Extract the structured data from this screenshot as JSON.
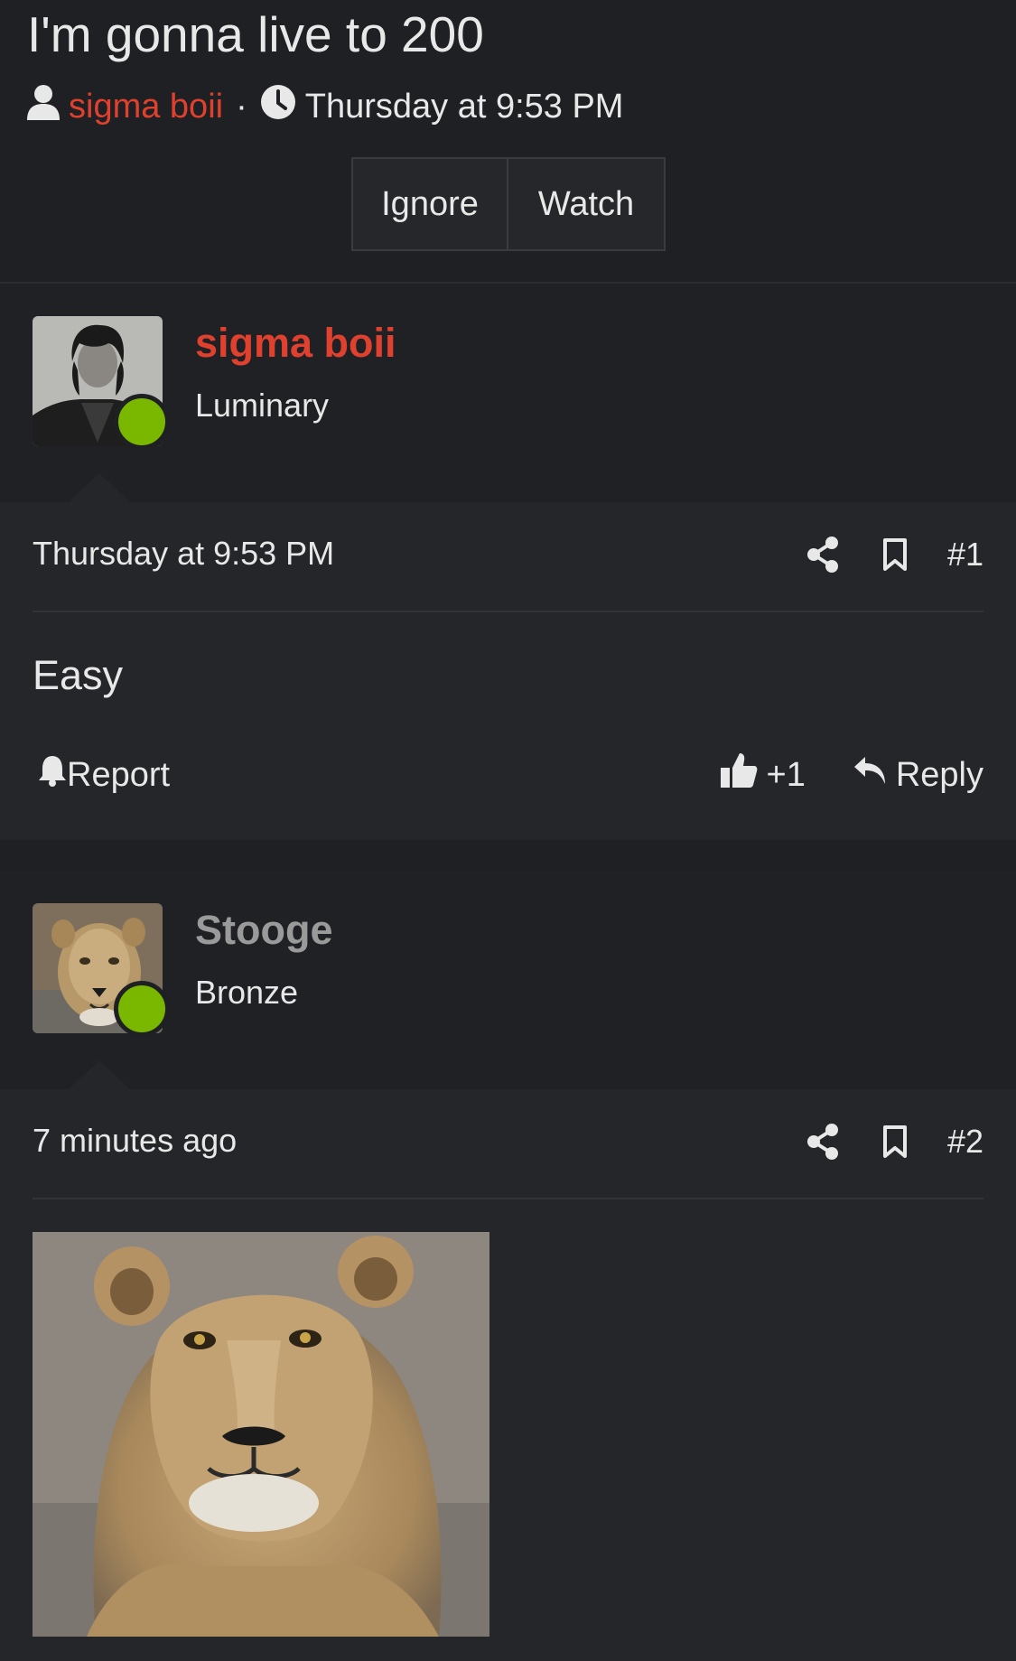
{
  "thread": {
    "title": "I'm gonna live to 200",
    "author": "sigma boii",
    "separator": "·",
    "time": "Thursday at 9:53 PM",
    "buttons": {
      "ignore": "Ignore",
      "watch": "Watch"
    }
  },
  "posts": [
    {
      "user": {
        "name": "sigma boii",
        "rank": "Luminary",
        "online": true
      },
      "date": "Thursday at 9:53 PM",
      "number": "#1",
      "body": "Easy",
      "report_label": "Report",
      "like_count": "+1",
      "reply_label": "Reply"
    },
    {
      "user": {
        "name": "Stooge",
        "rank": "Bronze",
        "online": true
      },
      "date": "7 minutes ago",
      "number": "#2"
    }
  ],
  "colors": {
    "accent": "#e0412f",
    "online": "#7ab800",
    "background": "#1f2023"
  },
  "icons": [
    "user-icon",
    "clock-icon",
    "share-icon",
    "bookmark-icon",
    "bell-icon",
    "thumbs-up-icon",
    "reply-icon"
  ]
}
